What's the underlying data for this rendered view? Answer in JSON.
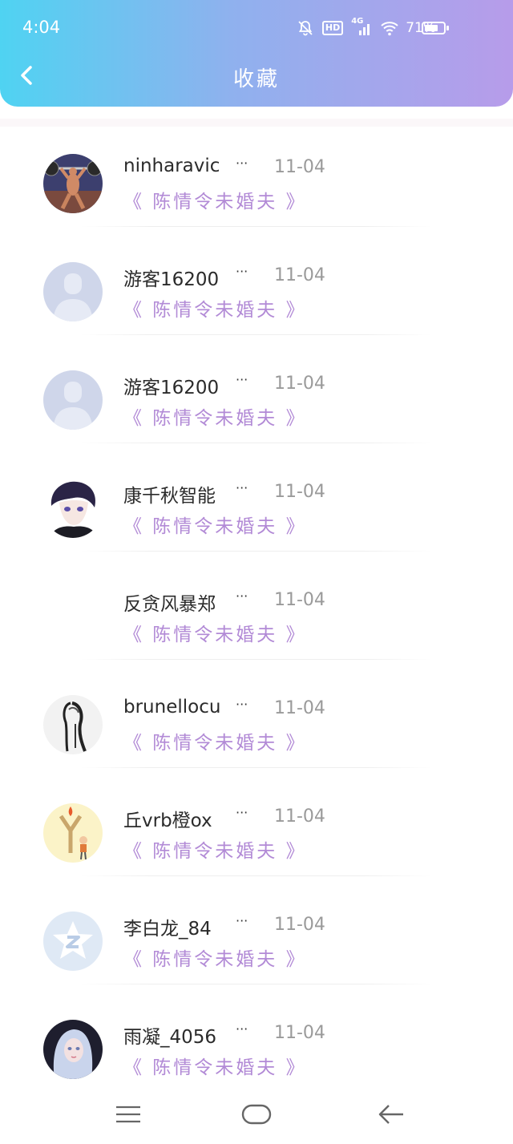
{
  "status_bar": {
    "time": "4:04",
    "network": "4G",
    "hd": "HD",
    "battery_percent": "71%",
    "battery_level": 0.71
  },
  "header": {
    "title": "收藏",
    "back_icon": "chevron-left-icon"
  },
  "colors": {
    "header_gradient_start": "#4fd3f2",
    "header_gradient_end": "#b79cea",
    "title_accent": "#b28ad6",
    "date_gray": "#9a9a9a"
  },
  "favorites": [
    {
      "user": "ninharavic",
      "date": "11-04",
      "title": "《 陈情令未婚夫 》",
      "avatar": "weightlifter-avatar"
    },
    {
      "user": "游客16200",
      "date": "11-04",
      "title": "《 陈情令未婚夫 》",
      "avatar": "default-person-avatar"
    },
    {
      "user": "游客16200",
      "date": "11-04",
      "title": "《 陈情令未婚夫 》",
      "avatar": "default-person-avatar"
    },
    {
      "user": "康千秋智能",
      "date": "11-04",
      "title": "《 陈情令未婚夫 》",
      "avatar": "anime-boy-avatar"
    },
    {
      "user": "反贪风暴郑",
      "date": "11-04",
      "title": "《 陈情令未婚夫 》",
      "avatar": "blank-avatar"
    },
    {
      "user": "brunellocu",
      "date": "11-04",
      "title": "《 陈情令未婚夫 》",
      "avatar": "sketch-figure-avatar"
    },
    {
      "user": "丘vrb橙ox",
      "date": "11-04",
      "title": "《 陈情令未婚夫 》",
      "avatar": "slingshot-cartoon-avatar"
    },
    {
      "user": "李白龙_84",
      "date": "11-04",
      "title": "《 陈情令未婚夫 》",
      "avatar": "qq-star-avatar"
    },
    {
      "user": "雨凝_4056",
      "date": "11-04",
      "title": "《 陈情令未婚夫 》",
      "avatar": "fantasy-girl-avatar"
    }
  ],
  "navbar": {
    "menu_icon": "menu-icon",
    "home_icon": "home-icon",
    "back_icon": "back-arrow-icon"
  }
}
